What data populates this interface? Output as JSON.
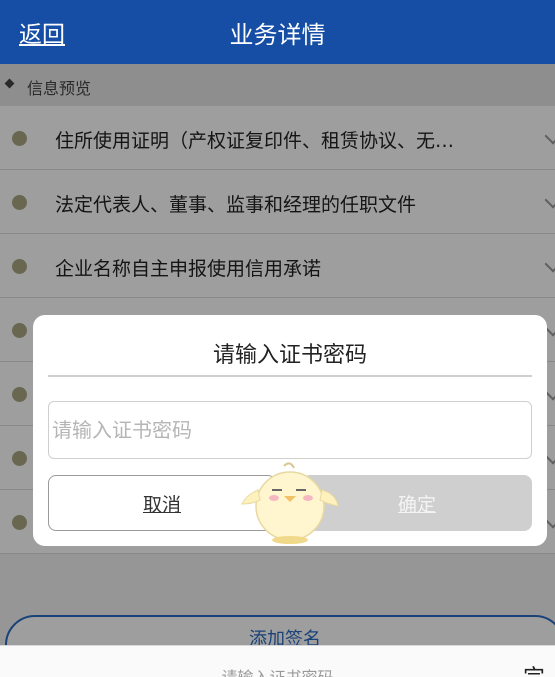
{
  "header": {
    "back_label": "返回",
    "title": "业务详情",
    "background_color": "#154ea4"
  },
  "section": {
    "label": "信息预览"
  },
  "list": {
    "items": [
      {
        "label": "住所使用证明（产权证复印件、租赁协议、无…"
      },
      {
        "label": "法定代表人、董事、监事和经理的任职文件"
      },
      {
        "label": "企业名称自主申报使用信用承诺"
      },
      {
        "label": ""
      },
      {
        "label": ""
      },
      {
        "label": ""
      },
      {
        "label": ""
      }
    ]
  },
  "bottom": {
    "add_sign_label": "添加签名",
    "keyboard_placeholder": "请输入证书密码",
    "keyboard_done": "完"
  },
  "dialog": {
    "title": "请输入证书密码",
    "input_placeholder": "请输入证书密码",
    "input_value": "",
    "cancel_label": "取消",
    "confirm_label": "确定"
  },
  "icons": {
    "mascot": "chick-mascot-icon",
    "bullet": "bullet-dot-icon",
    "chevron": "chevron-down-icon",
    "section_marker": "diamond-icon"
  }
}
